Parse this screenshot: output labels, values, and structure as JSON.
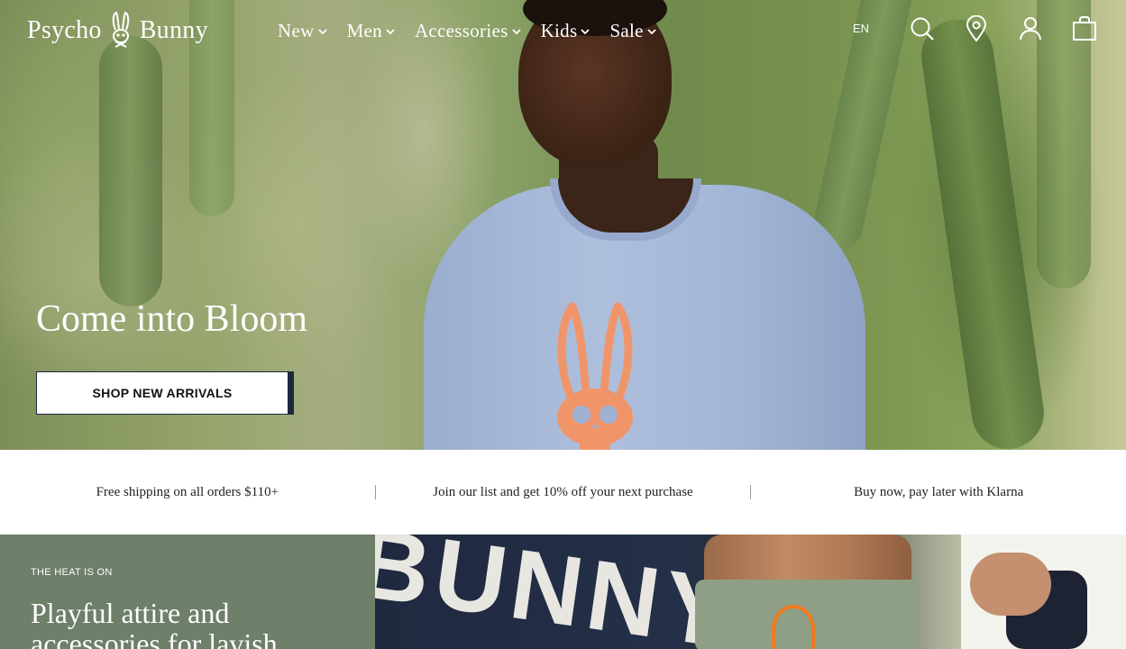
{
  "brand": {
    "name_left": "Psycho",
    "name_right": "Bunny"
  },
  "nav": {
    "items": [
      {
        "label": "New"
      },
      {
        "label": "Men"
      },
      {
        "label": "Accessories"
      },
      {
        "label": "Kids"
      },
      {
        "label": "Sale"
      }
    ]
  },
  "header": {
    "language": "EN",
    "icons": [
      "search-icon",
      "location-pin-icon",
      "account-icon",
      "shopping-bag-icon"
    ]
  },
  "hero": {
    "title": "Come into Bloom",
    "cta_label": "SHOP NEW ARRIVALS"
  },
  "promo": {
    "items": [
      "Free shipping on all orders $110+",
      "Join our list and get 10% off your next purchase",
      "Buy now, pay later with Klarna"
    ]
  },
  "feature": {
    "eyebrow": "THE HEAT IS ON",
    "title": "Playful attire and accessories for lavish",
    "towel_text": "BUNNY"
  },
  "colors": {
    "feature_panel": "#6e7f6a",
    "cta_border": "#1b2a3a",
    "shirt": "#a3b6d6",
    "bunny_logo": "#f0956a"
  }
}
